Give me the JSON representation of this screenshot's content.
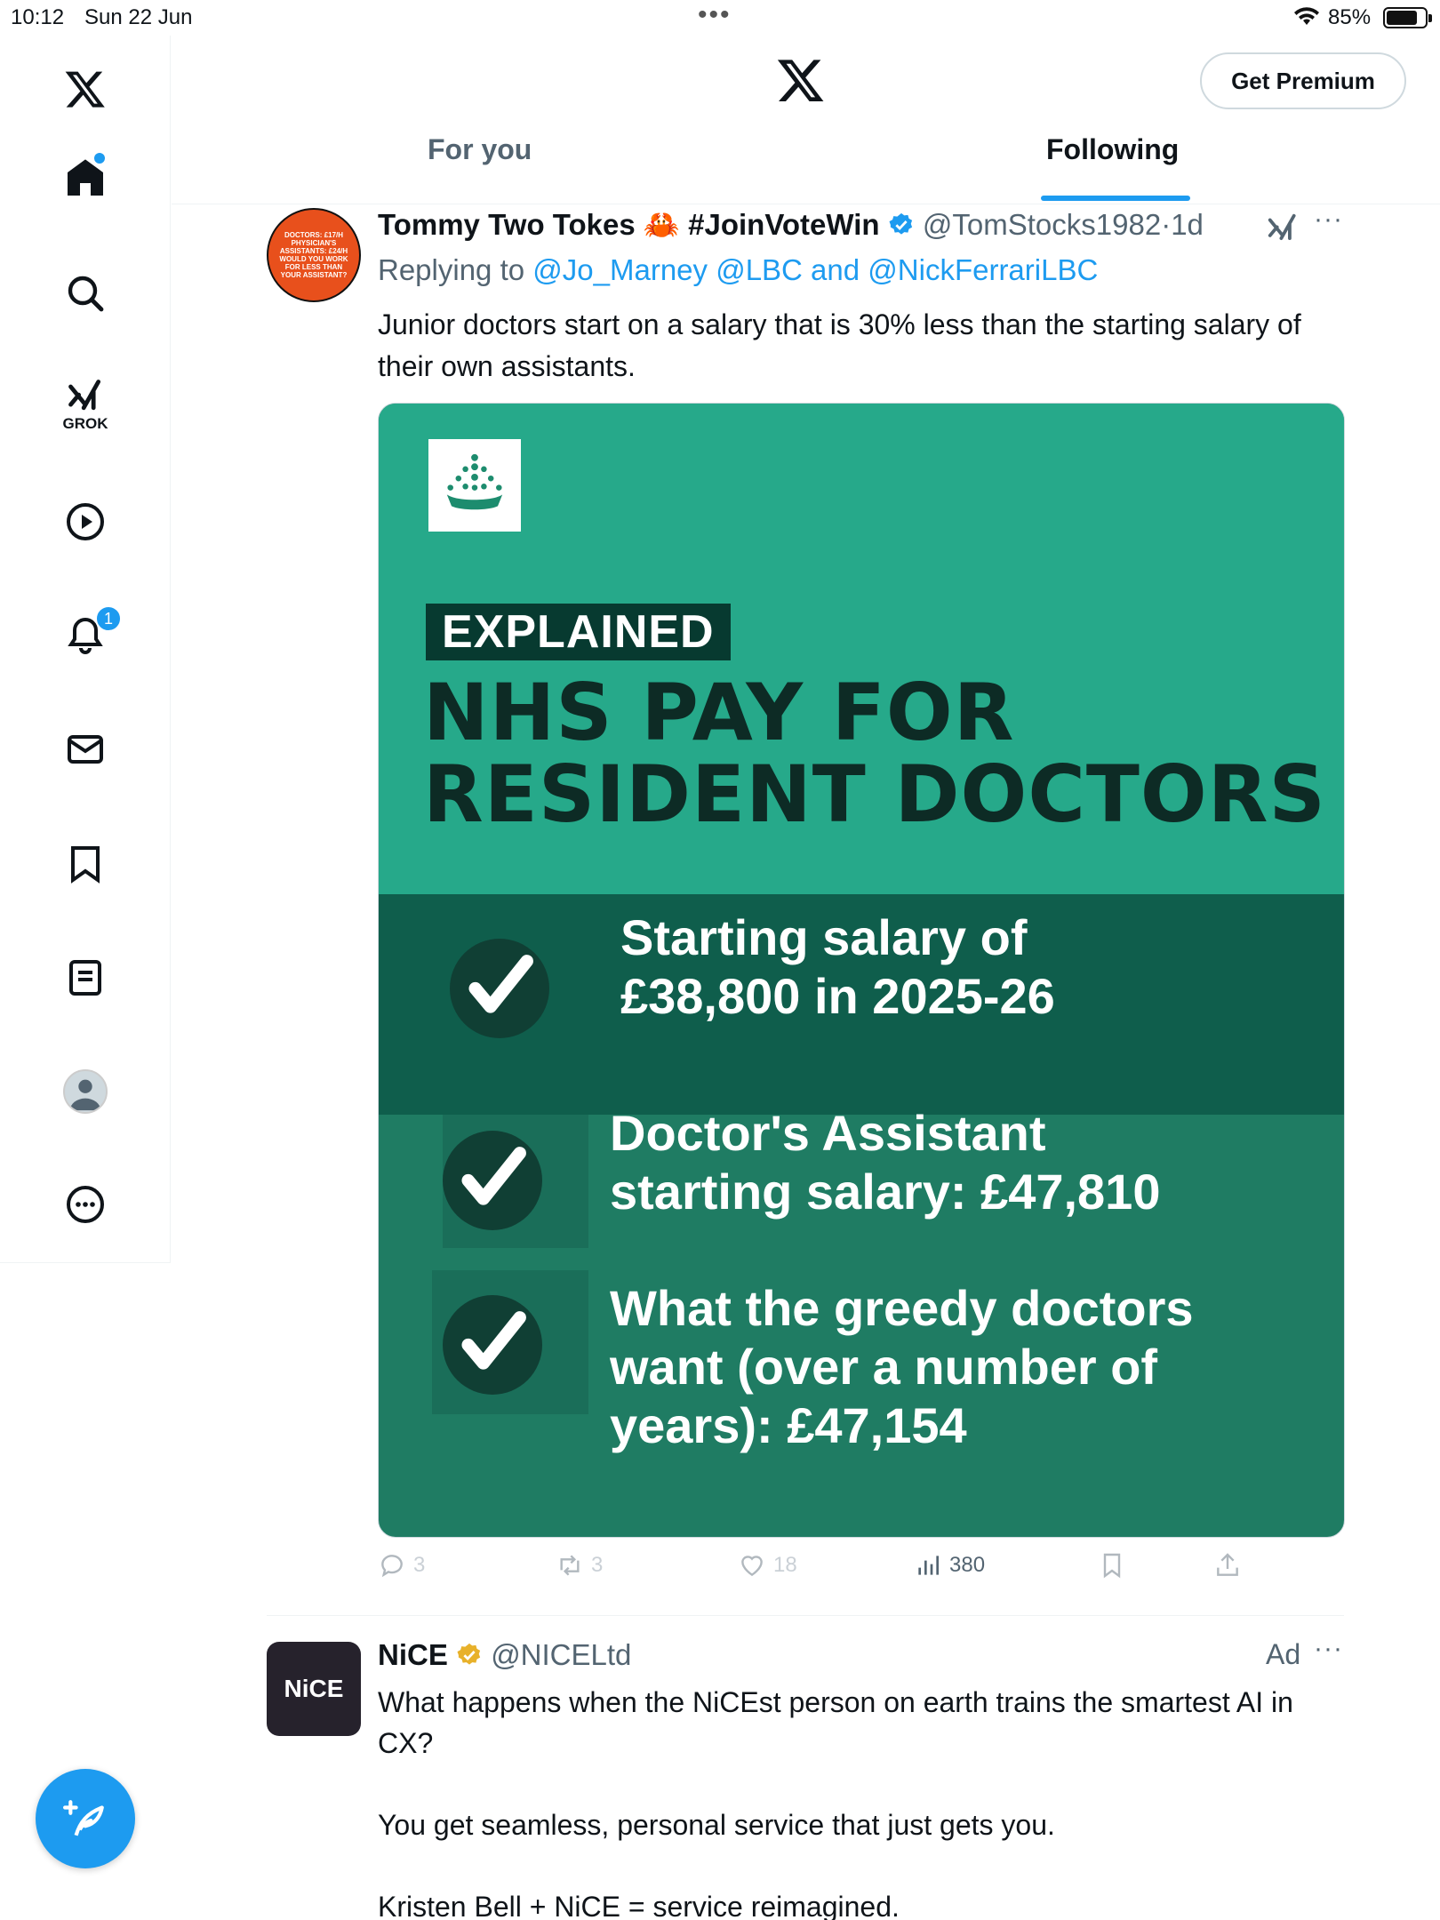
{
  "status_bar": {
    "time": "10:12",
    "date": "Sun 22 Jun",
    "battery": "85%"
  },
  "nav": {
    "grok_label": "GROK",
    "notifications_badge": "1"
  },
  "header": {
    "premium_button": "Get Premium",
    "tabs": [
      {
        "label": "For you",
        "active": false
      },
      {
        "label": "Following",
        "active": true
      }
    ]
  },
  "tweet": {
    "avatar_text": "Doctors: £17/h Physician's Assistants: £24/h WOULD YOU WORK FOR LESS THAN YOUR ASSISTANT?",
    "display_name": "Tommy Two Tokes 🦀 #JoinVoteWin",
    "handle": "@TomStocks1982",
    "separator": "·",
    "time": "1d",
    "replying_prefix": "Replying to",
    "replying_mentions": "@Jo_Marney @LBC and @NickFerrariLBC",
    "text": "Junior doctors start on a salary that is 30% less than the starting salary of their own assistants.",
    "image": {
      "tag": "EXPLAINED",
      "headline_line1": "NHS PAY FOR",
      "headline_line2": "RESIDENT DOCTORS",
      "points": [
        {
          "line1": "Starting salary of",
          "line2": "£38,800 in 2025-26",
          "line3": ""
        },
        {
          "line1": "Doctor's Assistant",
          "line2": "starting salary: £47,810",
          "line3": ""
        },
        {
          "line1": "What the greedy doctors",
          "line2": "want (over a number of",
          "line3": "years): £47,154"
        }
      ]
    },
    "stats": {
      "replies": "3",
      "reposts": "3",
      "likes": "18",
      "views": "380"
    }
  },
  "ad": {
    "avatar_text": "NiCE",
    "display_name": "NiCE",
    "handle": "@NICELtd",
    "label": "Ad",
    "paragraphs": [
      "What happens when the NiCEst person on earth trains the smartest AI in CX?",
      "You get seamless, personal service that just gets you.",
      "Kristen Bell + NiCE = service reimagined."
    ]
  },
  "colors": {
    "accent": "#1d9bf0",
    "card_teal": "#26a98a",
    "card_dark": "#1f7c63",
    "gold_verified": "#e8b12a"
  }
}
